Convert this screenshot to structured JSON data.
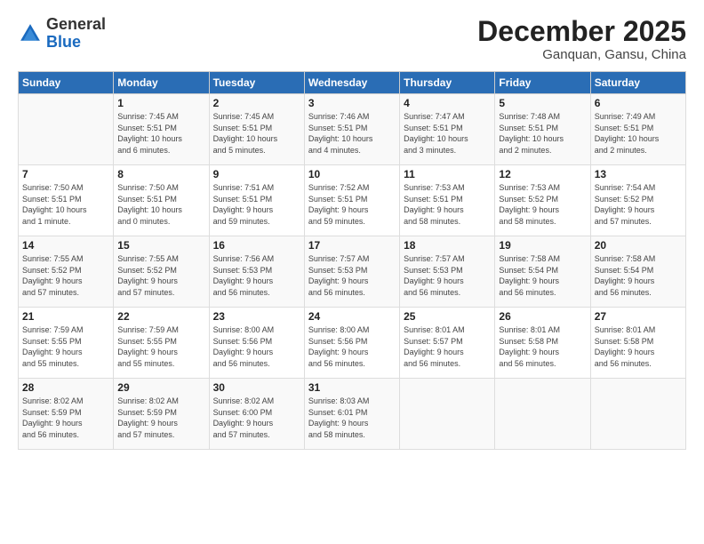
{
  "header": {
    "logo_general": "General",
    "logo_blue": "Blue",
    "month_title": "December 2025",
    "location": "Ganquan, Gansu, China"
  },
  "days_of_week": [
    "Sunday",
    "Monday",
    "Tuesday",
    "Wednesday",
    "Thursday",
    "Friday",
    "Saturday"
  ],
  "weeks": [
    [
      {
        "day": "",
        "content": ""
      },
      {
        "day": "1",
        "content": "Sunrise: 7:45 AM\nSunset: 5:51 PM\nDaylight: 10 hours\nand 6 minutes."
      },
      {
        "day": "2",
        "content": "Sunrise: 7:45 AM\nSunset: 5:51 PM\nDaylight: 10 hours\nand 5 minutes."
      },
      {
        "day": "3",
        "content": "Sunrise: 7:46 AM\nSunset: 5:51 PM\nDaylight: 10 hours\nand 4 minutes."
      },
      {
        "day": "4",
        "content": "Sunrise: 7:47 AM\nSunset: 5:51 PM\nDaylight: 10 hours\nand 3 minutes."
      },
      {
        "day": "5",
        "content": "Sunrise: 7:48 AM\nSunset: 5:51 PM\nDaylight: 10 hours\nand 2 minutes."
      },
      {
        "day": "6",
        "content": "Sunrise: 7:49 AM\nSunset: 5:51 PM\nDaylight: 10 hours\nand 2 minutes."
      }
    ],
    [
      {
        "day": "7",
        "content": "Sunrise: 7:50 AM\nSunset: 5:51 PM\nDaylight: 10 hours\nand 1 minute."
      },
      {
        "day": "8",
        "content": "Sunrise: 7:50 AM\nSunset: 5:51 PM\nDaylight: 10 hours\nand 0 minutes."
      },
      {
        "day": "9",
        "content": "Sunrise: 7:51 AM\nSunset: 5:51 PM\nDaylight: 9 hours\nand 59 minutes."
      },
      {
        "day": "10",
        "content": "Sunrise: 7:52 AM\nSunset: 5:51 PM\nDaylight: 9 hours\nand 59 minutes."
      },
      {
        "day": "11",
        "content": "Sunrise: 7:53 AM\nSunset: 5:51 PM\nDaylight: 9 hours\nand 58 minutes."
      },
      {
        "day": "12",
        "content": "Sunrise: 7:53 AM\nSunset: 5:52 PM\nDaylight: 9 hours\nand 58 minutes."
      },
      {
        "day": "13",
        "content": "Sunrise: 7:54 AM\nSunset: 5:52 PM\nDaylight: 9 hours\nand 57 minutes."
      }
    ],
    [
      {
        "day": "14",
        "content": "Sunrise: 7:55 AM\nSunset: 5:52 PM\nDaylight: 9 hours\nand 57 minutes."
      },
      {
        "day": "15",
        "content": "Sunrise: 7:55 AM\nSunset: 5:52 PM\nDaylight: 9 hours\nand 57 minutes."
      },
      {
        "day": "16",
        "content": "Sunrise: 7:56 AM\nSunset: 5:53 PM\nDaylight: 9 hours\nand 56 minutes."
      },
      {
        "day": "17",
        "content": "Sunrise: 7:57 AM\nSunset: 5:53 PM\nDaylight: 9 hours\nand 56 minutes."
      },
      {
        "day": "18",
        "content": "Sunrise: 7:57 AM\nSunset: 5:53 PM\nDaylight: 9 hours\nand 56 minutes."
      },
      {
        "day": "19",
        "content": "Sunrise: 7:58 AM\nSunset: 5:54 PM\nDaylight: 9 hours\nand 56 minutes."
      },
      {
        "day": "20",
        "content": "Sunrise: 7:58 AM\nSunset: 5:54 PM\nDaylight: 9 hours\nand 56 minutes."
      }
    ],
    [
      {
        "day": "21",
        "content": "Sunrise: 7:59 AM\nSunset: 5:55 PM\nDaylight: 9 hours\nand 55 minutes."
      },
      {
        "day": "22",
        "content": "Sunrise: 7:59 AM\nSunset: 5:55 PM\nDaylight: 9 hours\nand 55 minutes."
      },
      {
        "day": "23",
        "content": "Sunrise: 8:00 AM\nSunset: 5:56 PM\nDaylight: 9 hours\nand 56 minutes."
      },
      {
        "day": "24",
        "content": "Sunrise: 8:00 AM\nSunset: 5:56 PM\nDaylight: 9 hours\nand 56 minutes."
      },
      {
        "day": "25",
        "content": "Sunrise: 8:01 AM\nSunset: 5:57 PM\nDaylight: 9 hours\nand 56 minutes."
      },
      {
        "day": "26",
        "content": "Sunrise: 8:01 AM\nSunset: 5:58 PM\nDaylight: 9 hours\nand 56 minutes."
      },
      {
        "day": "27",
        "content": "Sunrise: 8:01 AM\nSunset: 5:58 PM\nDaylight: 9 hours\nand 56 minutes."
      }
    ],
    [
      {
        "day": "28",
        "content": "Sunrise: 8:02 AM\nSunset: 5:59 PM\nDaylight: 9 hours\nand 56 minutes."
      },
      {
        "day": "29",
        "content": "Sunrise: 8:02 AM\nSunset: 5:59 PM\nDaylight: 9 hours\nand 57 minutes."
      },
      {
        "day": "30",
        "content": "Sunrise: 8:02 AM\nSunset: 6:00 PM\nDaylight: 9 hours\nand 57 minutes."
      },
      {
        "day": "31",
        "content": "Sunrise: 8:03 AM\nSunset: 6:01 PM\nDaylight: 9 hours\nand 58 minutes."
      },
      {
        "day": "",
        "content": ""
      },
      {
        "day": "",
        "content": ""
      },
      {
        "day": "",
        "content": ""
      }
    ]
  ]
}
